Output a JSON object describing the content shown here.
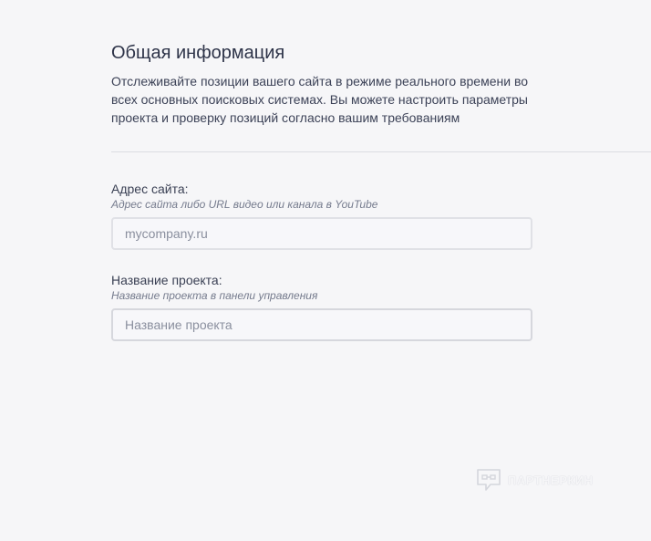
{
  "section": {
    "title": "Общая информация",
    "description": "Отслеживайте позиции вашего сайта в режиме реального времени во всех основных поисковых системах. Вы можете настроить параметры проекта и проверку позиций согласно вашим требованиям"
  },
  "fields": {
    "site_url": {
      "label": "Адрес сайта:",
      "hint": "Адрес сайта либо URL видео или канала в YouTube",
      "value": "",
      "placeholder": "mycompany.ru"
    },
    "project_name": {
      "label": "Название проекта:",
      "hint": "Название проекта в панели управления",
      "value": "",
      "placeholder": "Название проекта"
    }
  },
  "watermark": {
    "text": "ПАРТНЕРКИН",
    "icon": "partnerkin-logo-icon"
  }
}
